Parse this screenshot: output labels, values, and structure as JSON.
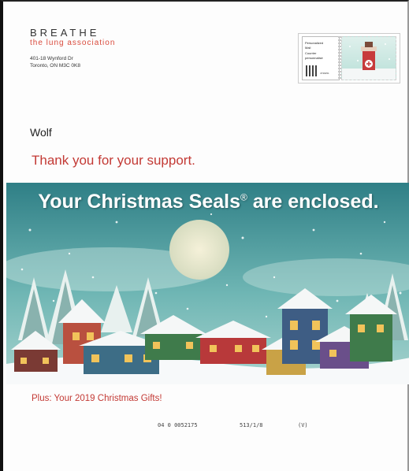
{
  "sender": {
    "name": "BREATHE",
    "tagline": "the lung association",
    "address_line1": "401-18 Wynford Dr",
    "address_line2": "Toronto, ON M3C 0K8"
  },
  "postage": {
    "indicia_lines": [
      "Personalized",
      "Mail",
      "Courrier",
      "personnalisé"
    ],
    "indicia_number": "4736451"
  },
  "recipient": {
    "name": "Wolf"
  },
  "message": {
    "thanks": "Thank you for your support.",
    "headline": "Your Christmas Seals",
    "headline_mark": "®",
    "headline_end": "are enclosed.",
    "plus": "Plus: Your 2019 Christmas Gifts!"
  },
  "codes": {
    "line1": "04  0 0052175",
    "line2": "513/1/8",
    "line3": "(V)"
  },
  "colors": {
    "accent_red": "#c33a35",
    "sky": "#4f9ea1",
    "snow": "#f7f9fa"
  }
}
